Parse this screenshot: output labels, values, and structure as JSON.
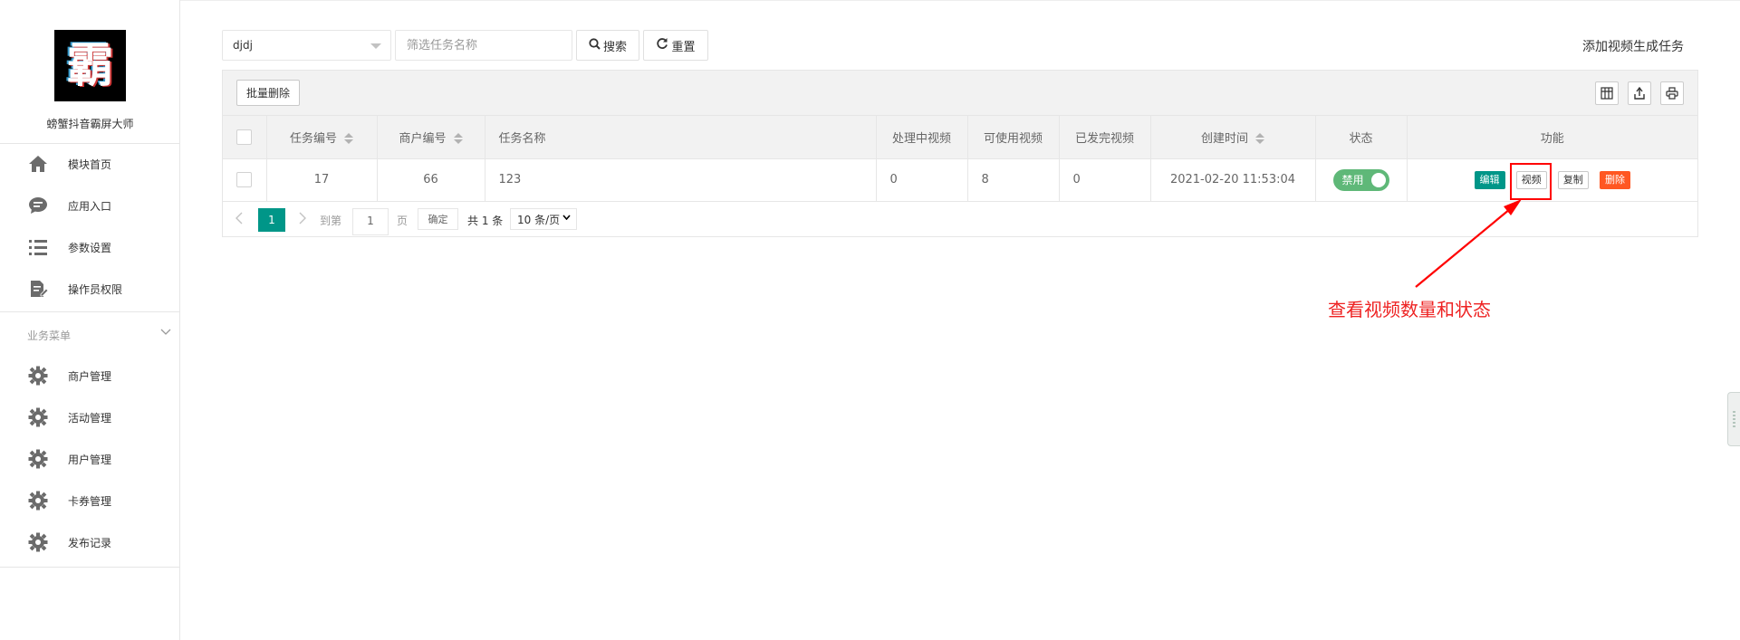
{
  "sidebar": {
    "logo_char": "霸",
    "brand": "螃蟹抖音霸屏大师",
    "items": [
      {
        "label": "模块首页",
        "icon": "home-icon"
      },
      {
        "label": "应用入口",
        "icon": "chat-bubble-icon"
      },
      {
        "label": "参数设置",
        "icon": "list-icon"
      },
      {
        "label": "操作员权限",
        "icon": "edit-document-icon"
      }
    ],
    "group_title": "业务菜单",
    "group_items": [
      {
        "label": "商户管理",
        "icon": "gear-icon"
      },
      {
        "label": "活动管理",
        "icon": "gear-icon"
      },
      {
        "label": "用户管理",
        "icon": "gear-icon"
      },
      {
        "label": "卡券管理",
        "icon": "gear-icon"
      },
      {
        "label": "发布记录",
        "icon": "gear-icon"
      }
    ]
  },
  "toolbar": {
    "select_value": "djdj",
    "search_placeholder": "筛选任务名称",
    "search_label": "搜索",
    "reset_label": "重置",
    "add_task_label": "添加视频生成任务"
  },
  "table": {
    "batch_delete_label": "批量删除",
    "tool_icons": [
      "columns-icon",
      "export-icon",
      "print-icon"
    ],
    "columns": [
      "任务编号",
      "商户编号",
      "任务名称",
      "处理中视频",
      "可使用视频",
      "已发完视频",
      "创建时间",
      "状态",
      "功能"
    ],
    "rows": [
      {
        "task_id": "17",
        "merchant_id": "66",
        "task_name": "123",
        "processing": "0",
        "available": "8",
        "finished": "0",
        "created": "2021-02-20 11:53:04",
        "status_label": "禁用",
        "actions": {
          "edit": "编辑",
          "video": "视频",
          "copy": "复制",
          "delete": "删除"
        }
      }
    ]
  },
  "pagination": {
    "current_page": "1",
    "goto_label": "到第",
    "page_input": "1",
    "page_unit": "页",
    "confirm_label": "确定",
    "total_label": "共 1 条",
    "page_size": "10 条/页"
  },
  "annotation": {
    "text": "查看视频数量和状态",
    "color": "#ee2222"
  },
  "colors": {
    "primary": "#009688",
    "danger": "#ff5722",
    "switch_on": "#5fb878"
  }
}
